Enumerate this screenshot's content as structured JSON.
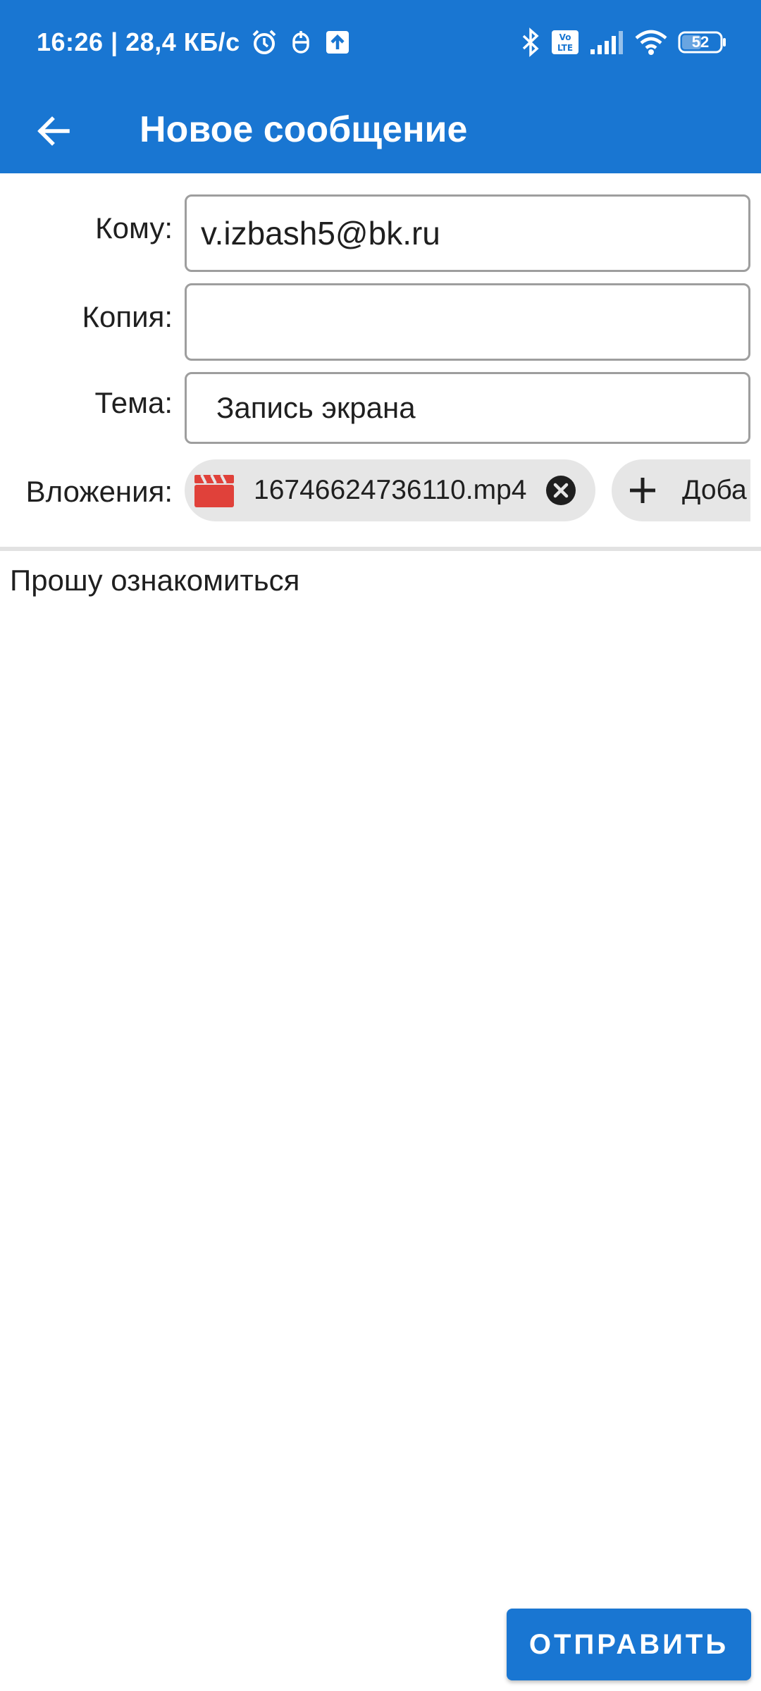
{
  "status_bar": {
    "time_speed": "16:26 | 28,4 КБ/с",
    "battery": "52",
    "volte": "Vo LTE",
    "icons": [
      "alarm-icon",
      "notification-icon",
      "upload-icon",
      "bluetooth-icon",
      "volte-icon",
      "signal-icon",
      "wifi-icon",
      "battery-icon"
    ]
  },
  "toolbar": {
    "back_icon": "arrow-left-icon",
    "title": "Новое сообщение"
  },
  "form": {
    "to_label": "Кому:",
    "to_value": "v.izbash5@bk.ru",
    "cc_label": "Копия:",
    "cc_value": "",
    "subject_label": "Тема:",
    "subject_value": "Запись экрана",
    "attachments_label": "Вложения:",
    "attachment_name": "16746624736110.mp4",
    "add_attachment_label": "Доба"
  },
  "body": {
    "text": "Прошу ознакомиться"
  },
  "actions": {
    "send_label": "ОТПРАВИТЬ"
  },
  "colors": {
    "primary": "#1976d2",
    "video_icon": "#e0413a",
    "chip_background": "#e6e6e6"
  }
}
